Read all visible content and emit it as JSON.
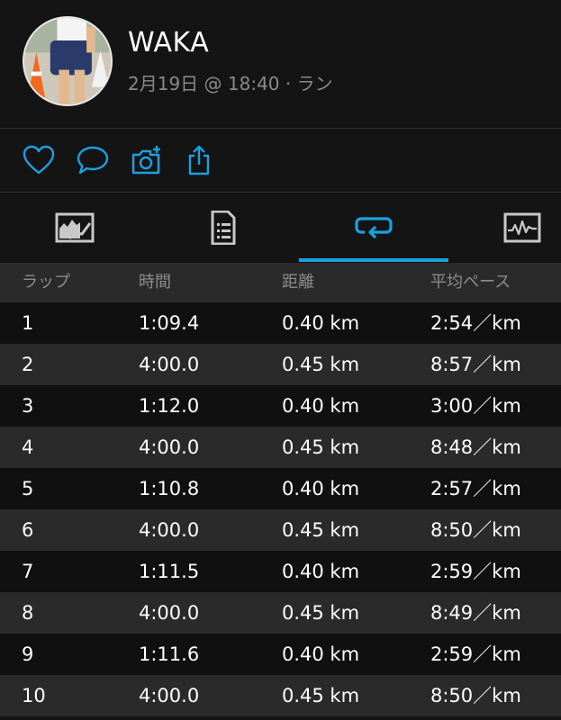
{
  "header": {
    "user_name": "WAKA",
    "activity_meta": "2月19日 @ 18:40 · ラン"
  },
  "actions": {
    "like_icon": "heart-icon",
    "comment_icon": "comment-icon",
    "photo_icon": "add-photo-icon",
    "share_icon": "share-icon"
  },
  "tabs": {
    "items": [
      "map-chart-tab",
      "stats-list-tab",
      "laps-tab",
      "graph-tab"
    ],
    "active_index": 2
  },
  "colors": {
    "accent": "#1da0e0",
    "background": "#141414",
    "row_alt": "#2a2a2a",
    "muted_text": "#8c8c8c"
  },
  "table": {
    "headers": {
      "lap": "ラップ",
      "time": "時間",
      "distance": "距離",
      "pace": "平均ペース"
    },
    "rows": [
      {
        "lap": "1",
        "time": "1:09.4",
        "distance": "0.40 km",
        "pace": "2:54／km"
      },
      {
        "lap": "2",
        "time": "4:00.0",
        "distance": "0.45 km",
        "pace": "8:57／km"
      },
      {
        "lap": "3",
        "time": "1:12.0",
        "distance": "0.40 km",
        "pace": "3:00／km"
      },
      {
        "lap": "4",
        "time": "4:00.0",
        "distance": "0.45 km",
        "pace": "8:48／km"
      },
      {
        "lap": "5",
        "time": "1:10.8",
        "distance": "0.40 km",
        "pace": "2:57／km"
      },
      {
        "lap": "6",
        "time": "4:00.0",
        "distance": "0.45 km",
        "pace": "8:50／km"
      },
      {
        "lap": "7",
        "time": "1:11.5",
        "distance": "0.40 km",
        "pace": "2:59／km"
      },
      {
        "lap": "8",
        "time": "4:00.0",
        "distance": "0.45 km",
        "pace": "8:49／km"
      },
      {
        "lap": "9",
        "time": "1:11.6",
        "distance": "0.40 km",
        "pace": "2:59／km"
      },
      {
        "lap": "10",
        "time": "4:00.0",
        "distance": "0.45 km",
        "pace": "8:50／km"
      }
    ]
  }
}
